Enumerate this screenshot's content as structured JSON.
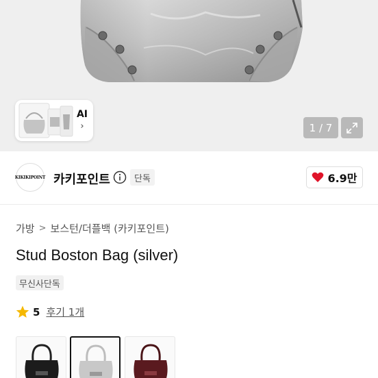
{
  "gallery": {
    "ai_label": "AI",
    "ai_chevron": "›",
    "counter": "1 / 7",
    "expand_icon": "expand-icon"
  },
  "brand": {
    "logo_text": "KIKIKIPOINT",
    "name": "카키포인트",
    "exclusive_badge": "단독",
    "like_count": "6.9만",
    "like_color": "#e0142a"
  },
  "breadcrumb": {
    "items": [
      "가방",
      "보스턴/더플백 (카키포인트)"
    ],
    "separator": ">"
  },
  "product": {
    "title": "Stud Boston Bag (silver)",
    "tag": "무신사단독",
    "rating": "5",
    "review_link": "후기 1개",
    "star_color": "#f5b800"
  },
  "variants": [
    {
      "name": "black",
      "selected": false
    },
    {
      "name": "silver",
      "selected": true
    },
    {
      "name": "burgundy",
      "selected": false
    }
  ]
}
